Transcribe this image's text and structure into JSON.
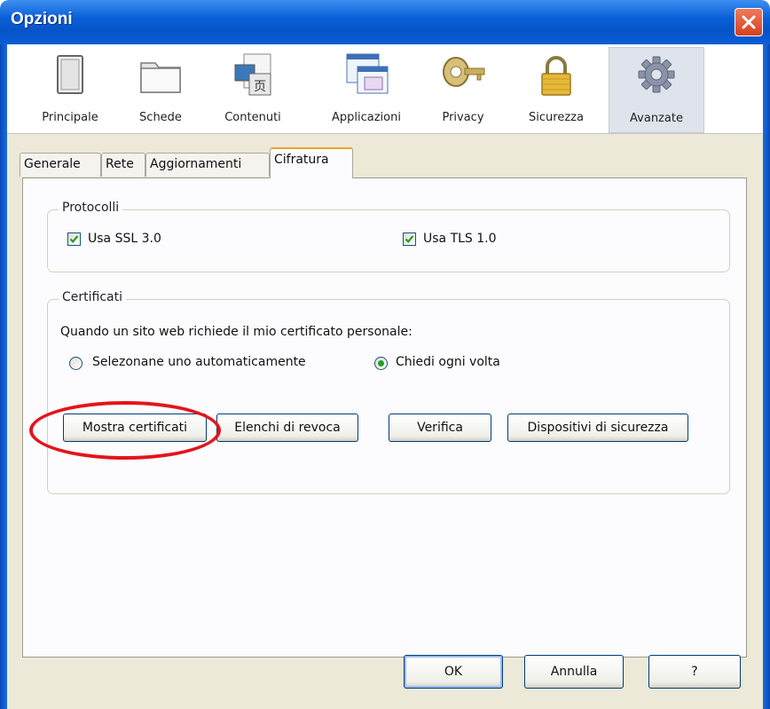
{
  "window": {
    "title": "Opzioni"
  },
  "toolbar": {
    "items": [
      {
        "label": "Principale",
        "icon": "principale-icon"
      },
      {
        "label": "Schede",
        "icon": "schede-icon"
      },
      {
        "label": "Contenuti",
        "icon": "contenuti-icon"
      },
      {
        "label": "Applicazioni",
        "icon": "applicazioni-icon"
      },
      {
        "label": "Privacy",
        "icon": "privacy-key-icon"
      },
      {
        "label": "Sicurezza",
        "icon": "padlock-icon"
      },
      {
        "label": "Avanzate",
        "icon": "gear-icon"
      }
    ],
    "selected": "Avanzate"
  },
  "tabs": [
    {
      "label": "Generale"
    },
    {
      "label": "Rete"
    },
    {
      "label": "Aggiornamenti"
    },
    {
      "label": "Cifratura"
    }
  ],
  "active_tab": "Cifratura",
  "protocolli": {
    "title": "Protocolli",
    "ssl_label": "Usa SSL 3.0",
    "ssl_checked": true,
    "tls_label": "Usa TLS 1.0",
    "tls_checked": true
  },
  "certificati": {
    "title": "Certificati",
    "prompt": "Quando un sito web richiede il mio certificato personale:",
    "radio_auto": "Selezonane uno automaticamente",
    "radio_ask": "Chiedi ogni volta",
    "selected_radio": "Chiedi ogni volta",
    "buttons": {
      "mostra": "Mostra certificati",
      "elenchi": "Elenchi di revoca",
      "verifica": "Verifica",
      "dispositivi": "Dispositivi di sicurezza"
    }
  },
  "footer": {
    "ok": "OK",
    "annulla": "Annulla",
    "help": "?"
  },
  "colors": {
    "titlebar": "#0654c8",
    "annotation": "#e4141b",
    "check": "#21a121"
  }
}
